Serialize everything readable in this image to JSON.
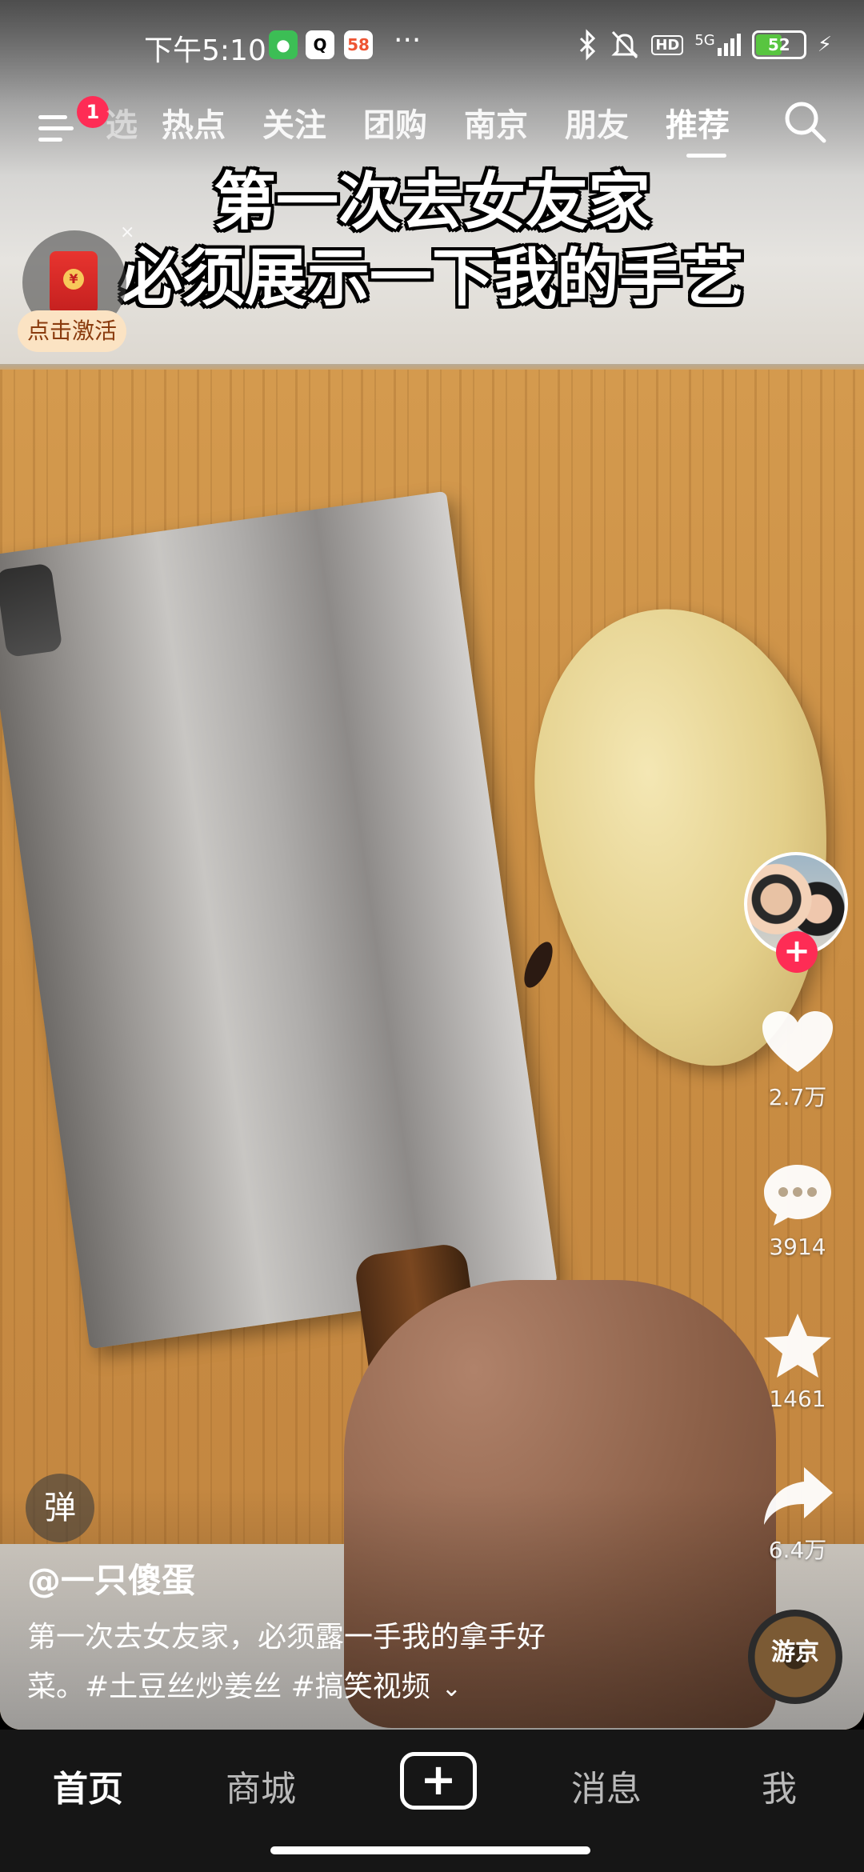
{
  "status_bar": {
    "time": "下午5:10",
    "app_icons": [
      "wechat-icon",
      "qq-icon",
      "58-icon"
    ],
    "more": "···",
    "network": "5G",
    "hd_label": "HD",
    "battery": "52"
  },
  "top_nav": {
    "menu_badge": "1",
    "tabs": [
      "选",
      "热点",
      "关注",
      "团购",
      "南京",
      "朋友",
      "推荐"
    ],
    "active_tab": "推荐"
  },
  "video": {
    "caption_line1": "第一次去女友家",
    "caption_line2": "必须展示一下我的手艺"
  },
  "red_packet": {
    "label": "点击激活",
    "coin_symbol": "¥",
    "close": "×"
  },
  "side_rail": {
    "follow": "+",
    "likes": "2.7万",
    "comments": "3914",
    "favorites": "1461",
    "shares": "6.4万"
  },
  "bottom_info": {
    "danmaku": "弹",
    "author": "@一只傻蛋",
    "description_line1": "第一次去女友家，必须露一手我的拿手好",
    "description_line2": "菜。#土豆丝炒姜丝 #搞笑视频",
    "expand": "⌄",
    "music_label": "游京"
  },
  "tab_bar": {
    "home": "首页",
    "mall": "商城",
    "create": "+",
    "messages": "消息",
    "me": "我"
  },
  "colors": {
    "accent": "#fe2c55",
    "tab_bar_bg": "#161616",
    "battery_green": "#58c540"
  }
}
